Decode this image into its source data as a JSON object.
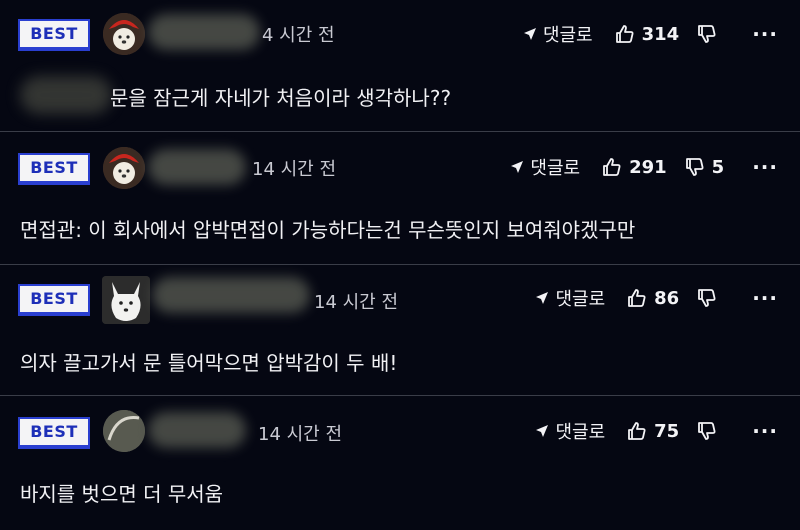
{
  "comments": [
    {
      "badge": "BEST",
      "time": "4 시간 전",
      "reply_label": "댓글로",
      "likes": "314",
      "dislikes": "",
      "more": "···",
      "text": "문을 잠근게 자네가 처음이라 생각하나??"
    },
    {
      "badge": "BEST",
      "time": "14 시간 전",
      "reply_label": "댓글로",
      "likes": "291",
      "dislikes": "5",
      "more": "···",
      "text": "면접관: 이 회사에서 압박면접이 가능하다는건 무슨뜻인지 보여줘야겠구만"
    },
    {
      "badge": "BEST",
      "time": "14 시간 전",
      "reply_label": "댓글로",
      "likes": "86",
      "dislikes": "",
      "more": "···",
      "text": "의자 끌고가서 문 틀어막으면 압박감이 두 배!"
    },
    {
      "badge": "BEST",
      "time": "14 시간 전",
      "reply_label": "댓글로",
      "likes": "75",
      "dislikes": "",
      "more": "···",
      "text": "바지를 벗으면 더 무서움"
    }
  ],
  "colors": {
    "background": "#050712",
    "badge_border": "#2a3fd0",
    "badge_text": "#1d2fb8",
    "divider": "#3a3d48"
  },
  "icons": {
    "reply": "reply-arrow-icon",
    "like": "thumbs-up-icon",
    "dislike": "thumbs-down-icon",
    "more": "more-dots-icon"
  }
}
